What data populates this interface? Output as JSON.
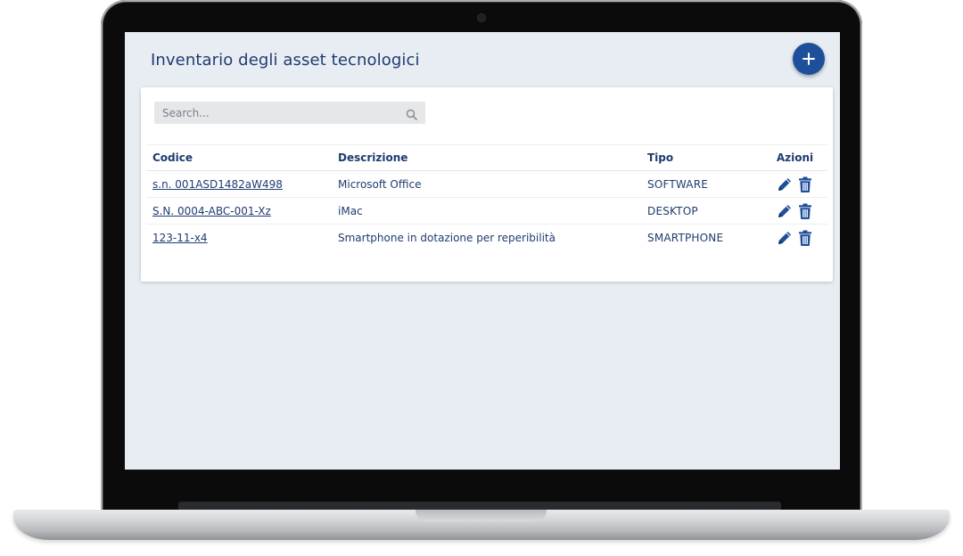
{
  "page": {
    "title": "Inventario degli asset tecnologici",
    "add_button_icon": "plus-icon"
  },
  "search": {
    "placeholder": "Search...",
    "value": "",
    "icon": "search-icon"
  },
  "table": {
    "headers": {
      "code": "Codice",
      "description": "Descrizione",
      "type": "Tipo",
      "actions": "Azioni"
    },
    "rows": [
      {
        "code": "s.n. 001ASD1482aW498",
        "description": "Microsoft Office",
        "type": "SOFTWARE"
      },
      {
        "code": "S.N. 0004-ABC-001-Xz",
        "description": "iMac",
        "type": "DESKTOP"
      },
      {
        "code": "123-11-x4",
        "description": "Smartphone in dotazione per reperibilità",
        "type": "SMARTPHONE"
      }
    ],
    "row_actions": [
      "pencil-icon",
      "trash-icon"
    ]
  },
  "colors": {
    "primary": "#1f3c70",
    "accent_button": "#1d4f9b",
    "screen_background": "#e8ecf3",
    "card_background": "#ffffff",
    "search_background": "#e6e7e9"
  }
}
